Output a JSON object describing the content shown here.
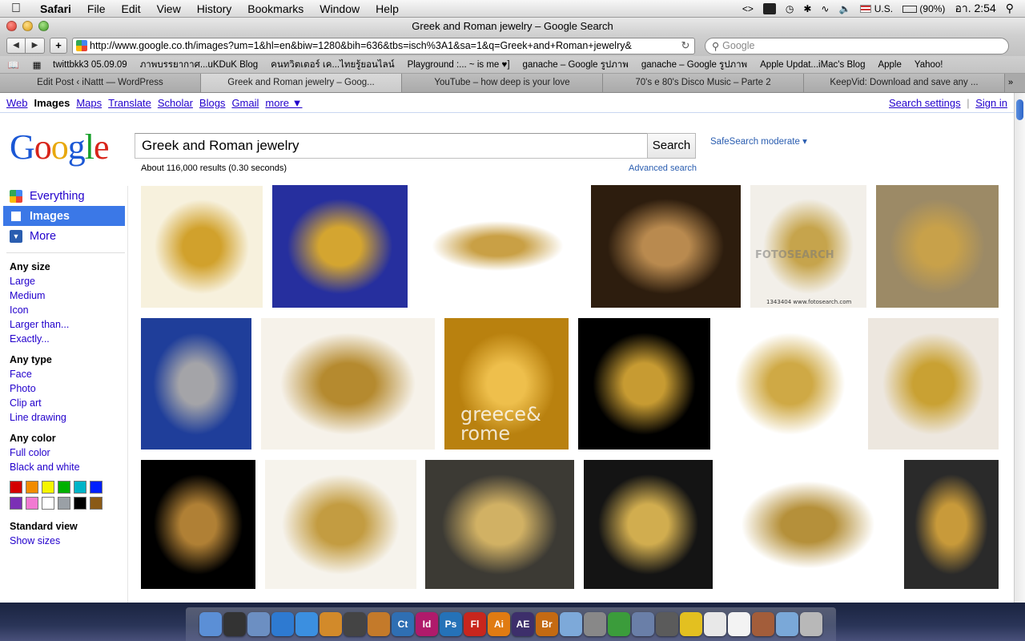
{
  "menubar": {
    "app": "Safari",
    "items": [
      "File",
      "Edit",
      "View",
      "History",
      "Bookmarks",
      "Window",
      "Help"
    ],
    "status": {
      "input_source": "U.S.",
      "battery": "(90%)",
      "clock": "อา. 2:54"
    }
  },
  "window": {
    "title": "Greek and Roman jewelry – Google Search"
  },
  "toolbar": {
    "url": "http://www.google.co.th/images?um=1&hl=en&biw=1280&bih=636&tbs=isch%3A1&sa=1&q=Greek+and+Roman+jewelry&",
    "search_placeholder": "Google"
  },
  "bookmarks": [
    "twittbkk3 05.09.09",
    "ภาพบรรยากาศ...uKDuK Blog",
    "คนทวิตเตอร์ เค...ไทยรู้ยอนไลน์",
    "Playground :... ~ is me ♥]",
    "ganache – Google รูปภาพ",
    "ganache – Google รูปภาพ",
    "Apple Updat...iMac's Blog",
    "Apple",
    "Yahoo!"
  ],
  "tabs": [
    {
      "label": "Edit Post ‹ iNattt — WordPress",
      "active": false
    },
    {
      "label": "Greek and Roman jewelry – Goog...",
      "active": true
    },
    {
      "label": "YouTube – how deep is your love",
      "active": false
    },
    {
      "label": "70's e 80's Disco Music – Parte 2",
      "active": false
    },
    {
      "label": "KeepVid: Download and save any ...",
      "active": false
    }
  ],
  "gbar": {
    "links": [
      "Web",
      "Images",
      "Maps",
      "Translate",
      "Scholar",
      "Blogs",
      "Gmail",
      "more ▼"
    ],
    "search_settings": "Search settings",
    "separator": "|",
    "sign_in": "Sign in"
  },
  "search": {
    "query": "Greek and Roman jewelry",
    "button": "Search",
    "safesearch": "SafeSearch moderate ▾",
    "stats": "About 116,000 results (0.30 seconds)",
    "advanced": "Advanced search"
  },
  "leftnav": {
    "modes": [
      {
        "label": "Everything",
        "icon": "everything-icon",
        "selected": false
      },
      {
        "label": "Images",
        "icon": "images-icon",
        "selected": true
      },
      {
        "label": "More",
        "icon": "more-icon",
        "selected": false
      }
    ],
    "size_title": "Any size",
    "sizes": [
      "Large",
      "Medium",
      "Icon",
      "Larger than...",
      "Exactly..."
    ],
    "type_title": "Any type",
    "types": [
      "Face",
      "Photo",
      "Clip art",
      "Line drawing"
    ],
    "color_title": "Any color",
    "colors_links": [
      "Full color",
      "Black and white"
    ],
    "swatch_colors": [
      "#d40000",
      "#f28c00",
      "#f5f500",
      "#00b000",
      "#00b4c8",
      "#0020ff",
      "#7b2fb5",
      "#f27ad2",
      "#ffffff",
      "#9aa0a6",
      "#000000",
      "#8a5a16"
    ],
    "view_title": "Standard view",
    "view_link": "Show sizes"
  },
  "results": {
    "thumb_captions": {
      "fotosearch_wm": "FOTOSEARCH",
      "fotosearch_id": "1343404  www.fotosearch.com",
      "greece_text": "greece& rome"
    },
    "thumbs": [
      {
        "name": "gold-laurel-wreath-image",
        "colors": [
          "#f7f1dd",
          "#d1a12c"
        ]
      },
      {
        "name": "gold-hair-ornament-blue-image",
        "colors": [
          "#262f9e",
          "#d4a530"
        ]
      },
      {
        "name": "gold-necklaces-earrings-image",
        "colors": [
          "#ffffff",
          "#c9a045"
        ]
      },
      {
        "name": "jewelry-pile-image",
        "colors": [
          "#2d1d0e",
          "#b98a4f"
        ]
      },
      {
        "name": "cameo-earrings-fotosearch-image",
        "colors": [
          "#f2efe9",
          "#c6a44c"
        ]
      },
      {
        "name": "gold-diadem-bracelets-image",
        "colors": [
          "#9c8a66",
          "#c8a14a"
        ]
      },
      {
        "name": "silver-ram-bracelet-image",
        "colors": [
          "#1f3e9a",
          "#a4a4a8"
        ]
      },
      {
        "name": "gold-disc-necklace-image",
        "colors": [
          "#f6f2ea",
          "#b58a2f"
        ]
      },
      {
        "name": "greece-and-rome-gold-image",
        "colors": [
          "#b9810f",
          "#eebf4c"
        ]
      },
      {
        "name": "gold-spiral-bracelet-image",
        "colors": [
          "#000000",
          "#c79b32"
        ]
      },
      {
        "name": "gold-bracelets-gems-image",
        "colors": [
          "#ffffff",
          "#cfa945"
        ]
      },
      {
        "name": "gold-oak-wreath-image",
        "colors": [
          "#ede7df",
          "#c9a133"
        ]
      },
      {
        "name": "gold-medallion-image",
        "colors": [
          "#000000",
          "#b08035"
        ]
      },
      {
        "name": "gold-hairnet-image",
        "colors": [
          "#f6f3ec",
          "#c39c41"
        ]
      },
      {
        "name": "gold-snake-ring-image",
        "colors": [
          "#3c3a34",
          "#d1b164"
        ]
      },
      {
        "name": "coin-brooch-image",
        "colors": [
          "#141414",
          "#d1ad4f"
        ]
      },
      {
        "name": "gold-fringe-necklace-image",
        "colors": [
          "#ffffff",
          "#b5903a"
        ]
      },
      {
        "name": "garnet-earrings-image",
        "colors": [
          "#2a2a2a",
          "#c89a3a"
        ]
      }
    ]
  },
  "dock": [
    {
      "label": "",
      "icon": "finder-icon",
      "color": "#5b8fd6"
    },
    {
      "label": "",
      "icon": "dashboard-icon",
      "color": "#333333"
    },
    {
      "label": "",
      "icon": "mail-icon",
      "color": "#6c8fc2"
    },
    {
      "label": "",
      "icon": "safari-icon",
      "color": "#2e7ad1"
    },
    {
      "label": "",
      "icon": "itunes-icon",
      "color": "#3b8fe0"
    },
    {
      "label": "",
      "icon": "iphoto-icon",
      "color": "#d28a2a"
    },
    {
      "label": "",
      "icon": "imovie-icon",
      "color": "#444444"
    },
    {
      "label": "",
      "icon": "garageband-icon",
      "color": "#c47a2a"
    },
    {
      "label": "Ct",
      "icon": "contribute-icon",
      "color": "#2f6fb3"
    },
    {
      "label": "Id",
      "icon": "indesign-icon",
      "color": "#b01a6b"
    },
    {
      "label": "Ps",
      "icon": "photoshop-icon",
      "color": "#2572b8"
    },
    {
      "label": "Fl",
      "icon": "flash-icon",
      "color": "#c8261d"
    },
    {
      "label": "Ai",
      "icon": "illustrator-icon",
      "color": "#e07b12"
    },
    {
      "label": "AE",
      "icon": "aftereffects-icon",
      "color": "#3d2f6b"
    },
    {
      "label": "Br",
      "icon": "bridge-icon",
      "color": "#c46a12"
    },
    {
      "label": "",
      "icon": "preview-icon",
      "color": "#7da9d9"
    },
    {
      "label": "",
      "icon": "utility-icon",
      "color": "#888888"
    },
    {
      "label": "",
      "icon": "chrome-icon",
      "color": "#3b9c3b"
    },
    {
      "label": "",
      "icon": "pen-icon",
      "color": "#6a7fa8"
    },
    {
      "label": "",
      "icon": "printer-icon",
      "color": "#5b5b5b"
    },
    {
      "label": "",
      "icon": "adium-icon",
      "color": "#e3c020"
    },
    {
      "label": "",
      "icon": "textedit-icon",
      "color": "#e8e8e8"
    },
    {
      "label": "",
      "icon": "stickies-icon",
      "color": "#f3f3f3"
    },
    {
      "label": "",
      "icon": "address-icon",
      "color": "#a35d3a"
    },
    {
      "label": "",
      "icon": "downloads-folder-icon",
      "color": "#7aa8d8"
    },
    {
      "label": "",
      "icon": "trash-icon",
      "color": "#b8b8b8"
    }
  ]
}
